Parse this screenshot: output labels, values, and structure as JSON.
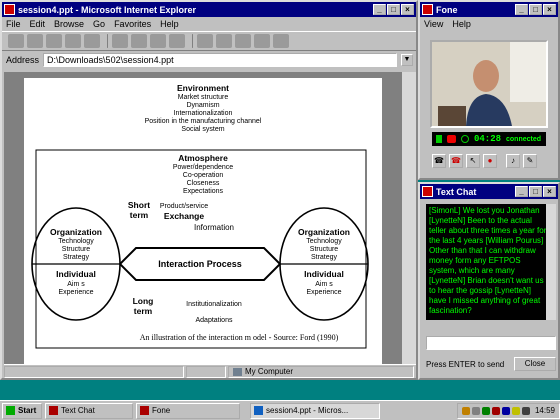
{
  "ie": {
    "title": "session4.ppt - Microsoft Internet Explorer",
    "menu": [
      "File",
      "Edit",
      "Browse",
      "Go",
      "Favorites",
      "Help"
    ],
    "address_label": "Address",
    "address_value": "D:\\Downloads\\502\\session4.ppt",
    "status_zone": "My Computer",
    "slide": {
      "environment_title": "Environment",
      "environment_items": [
        "Market structure",
        "Dynamism",
        "Internationalization",
        "Position in the manufacturing channel",
        "Social system"
      ],
      "atmosphere_title": "Atmosphere",
      "atmosphere_items": [
        "Power/dependence",
        "Co-operation",
        "Closeness",
        "Expectations"
      ],
      "left_org_title": "Organization",
      "left_org_items": [
        "Technology",
        "Structure",
        "Strategy"
      ],
      "left_ind_title": "Individual",
      "left_ind_items": [
        "Aim s",
        "Experience"
      ],
      "right_org_title": "Organization",
      "right_org_items": [
        "Technology",
        "Structure",
        "Strategy"
      ],
      "right_ind_title": "Individual",
      "right_ind_items": [
        "Aim s",
        "Experience"
      ],
      "short_term": "Short term",
      "exchange_a": "Product/service",
      "exchange_b": "Exchange",
      "exchange_c": "Information",
      "process": "Interaction Process",
      "long_term": "Long term",
      "adapt_a": "Institutionalization",
      "adapt_b": "Adaptations",
      "caption": "An illustration of the interaction m odel - Source: Ford (1990)"
    }
  },
  "fone": {
    "title": "Fone",
    "menu": [
      "View",
      "Help"
    ],
    "time": "04:28",
    "connection": "connected"
  },
  "chat": {
    "title": "Text Chat",
    "log": "[SimonL] We lost you Jonathan [LynetteN] Been to the actual teller about three times a year for the last 4 years [William Pourus] Other than that I can withdraw money form any EFTPOS system, which are many [LynetteN] Brian doesn't want us to hear the gossip [LynetteN] have I missed anything of great fascination?",
    "hint": "Press ENTER to send",
    "close_label": "Close"
  },
  "taskbar": {
    "start": "Start",
    "tasks": [
      "Text Chat",
      "Fone",
      "session4.ppt - Micros..."
    ],
    "clock": "14:59"
  },
  "colors": {
    "titlebar": "#000080",
    "chat_text": "#00ff00",
    "desktop": "#008080"
  }
}
